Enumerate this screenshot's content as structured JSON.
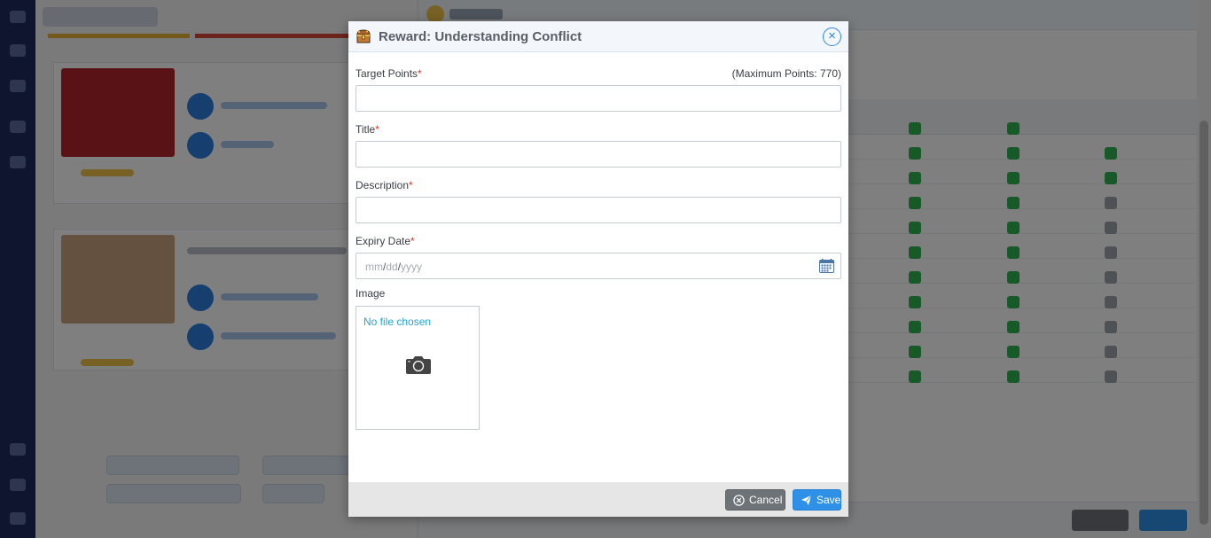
{
  "modal": {
    "title": "Reward: Understanding Conflict",
    "close_symbol": "×",
    "icons": {
      "title": "treasure-chest-icon",
      "close": "close-circle-icon",
      "calendar": "calendar-icon",
      "camera": "camera-icon",
      "cancel": "close-circle-icon",
      "save": "paper-plane-icon"
    },
    "max_points_text": "(Maximum Points: 770)",
    "required_mark": "*",
    "fields": {
      "target_points": {
        "label": "Target Points",
        "value": ""
      },
      "title": {
        "label": "Title",
        "value": ""
      },
      "description": {
        "label": "Description",
        "value": ""
      },
      "expiry_date": {
        "label": "Expiry Date",
        "placeholder_mm": "mm",
        "placeholder_dd": "dd",
        "placeholder_yyyy": "yyyy",
        "separator": "/"
      },
      "image": {
        "label": "Image",
        "status": "No file chosen"
      }
    },
    "buttons": {
      "cancel": "Cancel",
      "save": "Save"
    }
  },
  "colors": {
    "accent": "#2e90e6",
    "required": "#d9342b",
    "cancel_bg": "#6e7378",
    "link": "#26a4d6"
  }
}
